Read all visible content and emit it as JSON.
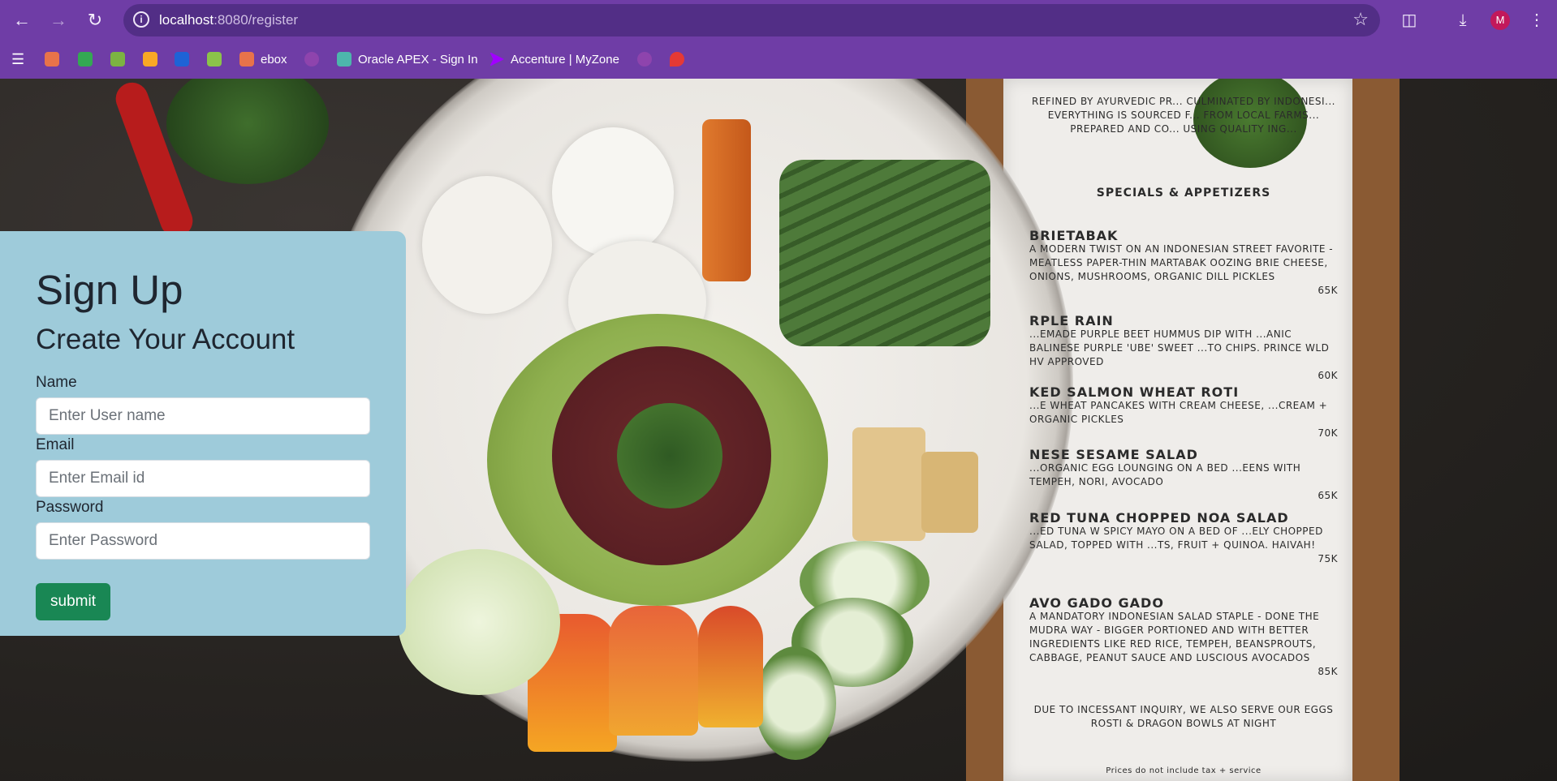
{
  "browser": {
    "url_host": "localhost",
    "url_path": ":8080/register",
    "avatar_letter": "M",
    "bookmarks": [
      {
        "label": "",
        "color": "#e8734a"
      },
      {
        "label": "",
        "color": "#34a853"
      },
      {
        "label": "",
        "color": "#7cb342"
      },
      {
        "label": "",
        "color": "#f9a825"
      },
      {
        "label": "",
        "color": "#1e63d6"
      },
      {
        "label": "",
        "color": "#8bc34a"
      },
      {
        "label": "ebox",
        "color": "#e8734a"
      },
      {
        "label": "",
        "color": "#8e44ad"
      },
      {
        "label": "Oracle APEX - Sign In",
        "color": "#4db6ac"
      },
      {
        "label": "Accenture | MyZone",
        "color": "#a100ff"
      },
      {
        "label": "",
        "color": "#8e44ad"
      },
      {
        "label": "",
        "color": "#e53935"
      }
    ]
  },
  "form": {
    "title": "Sign Up",
    "subtitle": "Create Your Account",
    "name_label": "Name",
    "name_placeholder": "Enter User name",
    "email_label": "Email",
    "email_placeholder": "Enter Email id",
    "password_label": "Password",
    "password_placeholder": "Enter Password",
    "submit_label": "submit"
  },
  "menu": {
    "intro": "Refined by Ayurvedic pr... culminated by Indonesi... everything is sourced f... from local farms... prepared and co... using quality ing...",
    "section": "Specials & Appetizers",
    "items": [
      {
        "name": "Brietabak",
        "desc": "A modern twist on an Indonesian street favorite - meatless paper-thin martabak oozing brie cheese, onions, mushrooms, organic dill pickles",
        "price": "65k"
      },
      {
        "name": "rple Rain",
        "desc": "...emade purple beet hummus dip with ...anic Balinese purple 'ube' sweet ...to chips. Prince WLD HV approved",
        "price": "60k"
      },
      {
        "name": "ked Salmon Wheat Roti",
        "desc": "...e wheat pancakes with cream cheese, ...cream + organic pickles",
        "price": "70k"
      },
      {
        "name": "nese Sesame Salad",
        "desc": "...organic egg lounging on a bed ...eens with tempeh, nori, avocado",
        "price": "65k"
      },
      {
        "name": "red Tuna Chopped noa Salad",
        "desc": "...ed tuna w spicy mayo on a bed of ...ely chopped salad, topped with ...ts, fruit + quinoa. Haivah!",
        "price": "75k"
      },
      {
        "name": "avo Gado Gado",
        "desc": "A mandatory Indonesian salad staple - done the Mudra way - bigger portioned and with better ingredients like red rice, tempeh, beansprouts, cabbage, peanut sauce and luscious avocados",
        "price": "85k"
      }
    ],
    "footer": "Due to incessant inquiry, we also serve our eggs rosti & dragon bowls at night",
    "fineprint": "Prices do not include tax + service"
  }
}
